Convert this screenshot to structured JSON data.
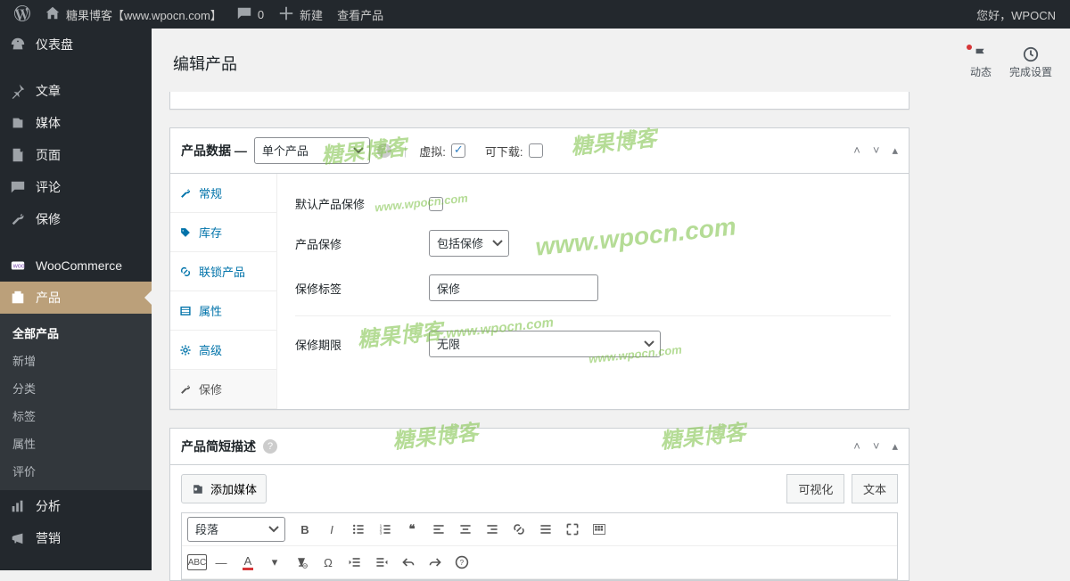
{
  "adminbar": {
    "site_name": "糖果博客【www.wpocn.com】",
    "comments_count": "0",
    "new_label": "新建",
    "view_product": "查看产品",
    "howdy": "您好，WPOCN"
  },
  "sidebar": {
    "items": [
      {
        "label": "仪表盘",
        "icon": "dashboard"
      },
      {
        "label": "文章",
        "icon": "pin"
      },
      {
        "label": "媒体",
        "icon": "media"
      },
      {
        "label": "页面",
        "icon": "page"
      },
      {
        "label": "评论",
        "icon": "comment"
      },
      {
        "label": "保修",
        "icon": "warranty"
      },
      {
        "label": "WooCommerce",
        "icon": "woo"
      },
      {
        "label": "产品",
        "icon": "product",
        "current": true
      },
      {
        "label": "分析",
        "icon": "analytics"
      },
      {
        "label": "营销",
        "icon": "marketing"
      }
    ],
    "submenu": [
      "全部产品",
      "新增",
      "分类",
      "标签",
      "属性",
      "评价"
    ],
    "submenu_current": "全部产品"
  },
  "header": {
    "title": "编辑产品",
    "activity": "动态",
    "finish_setup": "完成设置"
  },
  "product_data": {
    "box_title": "产品数据",
    "dash": "—",
    "type_value": "单个产品",
    "virtual_label": "虚拟:",
    "downloadable_label": "可下载:",
    "tabs": [
      "常规",
      "库存",
      "联锁产品",
      "属性",
      "高级",
      "保修"
    ],
    "active_tab": "保修",
    "fields": {
      "default_label": "默认产品保修",
      "warranty_label": "产品保修",
      "warranty_value": "包括保修",
      "tag_label": "保修标签",
      "tag_value": "保修",
      "term_label": "保修期限",
      "term_value": "无限"
    }
  },
  "short_desc": {
    "box_title": "产品简短描述",
    "add_media": "添加媒体",
    "tab_visual": "可视化",
    "tab_text": "文本",
    "format_select": "段落"
  },
  "watermark": "糖果博客",
  "watermark_url": "www.wpocn.com"
}
